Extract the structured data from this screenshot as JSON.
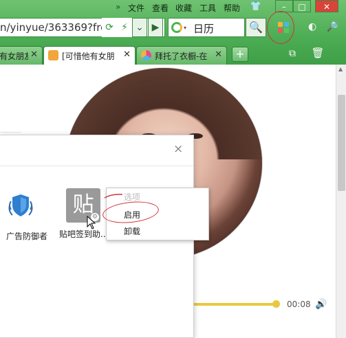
{
  "menubar": {
    "more": "»",
    "items": [
      "文件",
      "查看",
      "收藏",
      "工具",
      "帮助"
    ]
  },
  "window_controls": {
    "minimize": "–",
    "restore": "□",
    "close": "✕"
  },
  "address": {
    "url": "n/yinyue/363369?frc",
    "buttons": [
      "⟳",
      "⚡",
      "⌄",
      "▶"
    ]
  },
  "search": {
    "query": "日历",
    "engine_dropdown": "▾",
    "go": "🔍"
  },
  "toolbar_icons": [
    "◐",
    "🔎"
  ],
  "tabs": [
    {
      "title": "有女朋友",
      "close": "✕",
      "active": false
    },
    {
      "title": "[可惜他有女朋",
      "close": "✕",
      "active": true
    },
    {
      "title": "拜托了衣橱-在",
      "close": "✕",
      "active": false
    }
  ],
  "tabbar": {
    "new_tab": "+",
    "trash": "🗑",
    "restore": "⧉"
  },
  "player": {
    "time": "00:08",
    "progress": 0.93
  },
  "dialog": {
    "close": "×",
    "extensions": [
      {
        "label": "广告防御者"
      },
      {
        "label": "贴吧签到助...",
        "icon_text": "贴",
        "gear": "⚙"
      }
    ]
  },
  "context_menu": {
    "items": [
      {
        "label": "选项",
        "enabled": false
      },
      {
        "label": "启用",
        "enabled": true
      },
      {
        "label": "卸载",
        "enabled": true
      }
    ]
  },
  "colors": {
    "chrome_green": "#4eae55",
    "annotation_red": "#d0323a",
    "progress_yellow": "#e8c840",
    "close_red": "#d9433a"
  }
}
